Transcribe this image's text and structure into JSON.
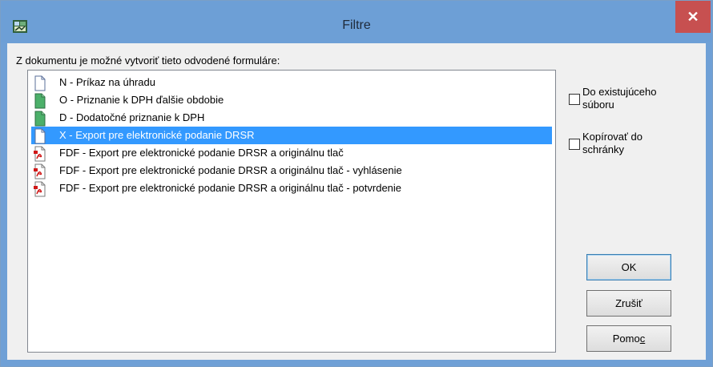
{
  "window": {
    "title": "Filtre",
    "close_symbol": "✕"
  },
  "dialog": {
    "prompt": "Z dokumentu je možné vytvoriť tieto odvodené formuláre:",
    "items": [
      {
        "label": "N - Príkaz na úhradu",
        "icon": "white-document-icon"
      },
      {
        "label": "O - Priznanie k DPH ďalšie obdobie",
        "icon": "green-document-icon"
      },
      {
        "label": "D - Dodatočné priznanie k DPH",
        "icon": "green-document-icon"
      },
      {
        "label": "X - Export pre elektronické podanie DRSR",
        "icon": "white-document-icon",
        "selected": true
      },
      {
        "label": "FDF - Export pre elektronické podanie DRSR a originálnu tlač",
        "icon": "pdf-document-icon"
      },
      {
        "label": "FDF - Export pre elektronické podanie DRSR a originálnu tlač - vyhlásenie",
        "icon": "pdf-document-icon"
      },
      {
        "label": "FDF - Export pre elektronické podanie DRSR a originálnu tlač - potvrdenie",
        "icon": "pdf-document-icon"
      }
    ],
    "checkbox_existing": {
      "line1": "Do existujúceho",
      "line2": "súboru",
      "checked": false
    },
    "checkbox_clipboard": {
      "line1": "Kopírovať do",
      "line2": "schránky",
      "checked": false
    },
    "buttons": {
      "ok": "OK",
      "cancel": "Zrušiť",
      "help_prefix": "Pomo",
      "help_accel": "c"
    }
  },
  "colors": {
    "titlebar": "#6d9fd6",
    "selection": "#3399ff",
    "close": "#c75050",
    "dialog_bg": "#f0f0f0"
  }
}
